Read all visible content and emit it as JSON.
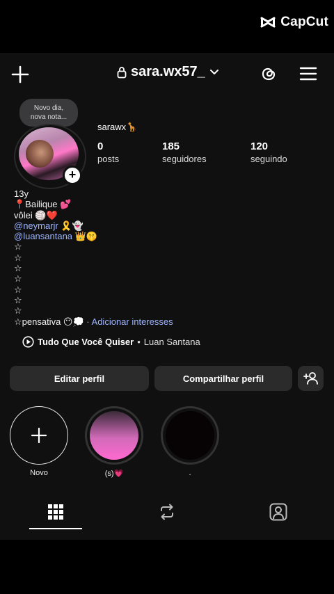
{
  "watermark": {
    "text": "CapCut",
    "icon": "capcut-logo-icon"
  },
  "header": {
    "username": "sara.wx57_",
    "icons": [
      "plus-icon",
      "lock-icon",
      "chevron-down-icon",
      "threads-icon",
      "hamburger-menu-icon"
    ]
  },
  "note": {
    "line1": "Novo dia,",
    "line2": "nova nota..."
  },
  "profile": {
    "display_name": "sarawx🦒",
    "stats": [
      {
        "value": "0",
        "label": "posts"
      },
      {
        "value": "185",
        "label": "seguidores"
      },
      {
        "value": "120",
        "label": "seguindo"
      }
    ]
  },
  "bio": {
    "line1": "13y",
    "line2": "📍Bailique 💕",
    "line3": "vôlei 🏐❤️",
    "mention1": "@neymarjr",
    "mention1_emoji": " 🎗️👻",
    "mention2": "@luansantana",
    "mention2_emoji": " 👑🤫",
    "stars": [
      "☆",
      "☆",
      "☆",
      "☆",
      "☆",
      "☆",
      "☆"
    ],
    "last_line": "☆pensativa 😶💭",
    "separator": "·",
    "link": "Adicionar interesses"
  },
  "music": {
    "song": "Tudo Que Você Quiser",
    "separator": "•",
    "artist": "Luan Santana"
  },
  "buttons": {
    "edit": "Editar perfil",
    "share": "Compartilhar perfil"
  },
  "highlights": [
    {
      "label": "Novo"
    },
    {
      "label": "(s)💗"
    },
    {
      "label": "."
    }
  ],
  "tabs": [
    "grid-icon",
    "reels-icon",
    "tagged-icon"
  ]
}
